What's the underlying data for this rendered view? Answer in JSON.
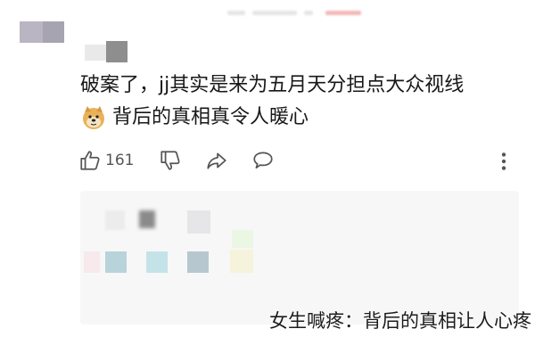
{
  "comment": {
    "line1": "破案了，jj其实是来为五月天分担点大众视线",
    "line2": "背后的真相真令人暖心"
  },
  "actions": {
    "like_count": "161"
  },
  "icons": [
    "thumbs-up-icon",
    "thumbs-down-icon",
    "share-icon",
    "comment-bubble-icon",
    "more-vertical-icon",
    "doge-emoji-icon"
  ],
  "watermark": "女生喊疼：背后的真相让人心疼",
  "colors": {
    "text": "#181818",
    "icon": "#555555",
    "reply_box_bg": "#f7f7f8"
  }
}
